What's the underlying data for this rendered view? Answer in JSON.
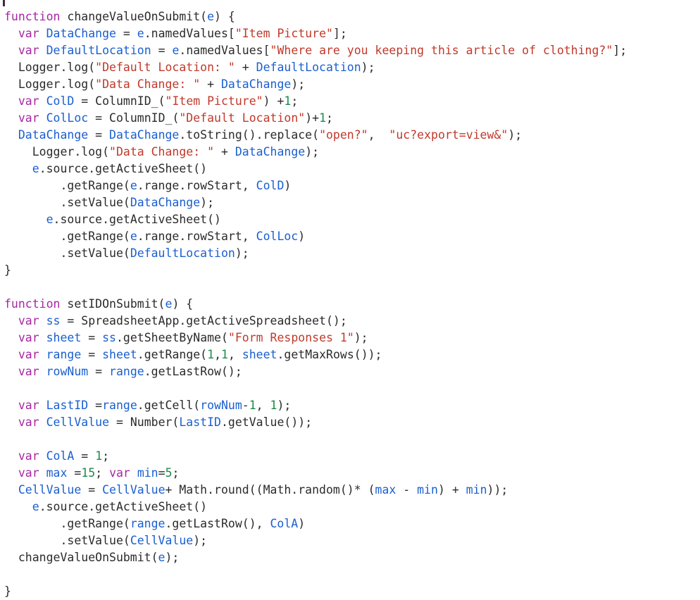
{
  "editor": {
    "name": "code-editor",
    "language": "JavaScript",
    "background_color": "#ffffff",
    "caret_visible": true,
    "theme_colors": {
      "keyword": "#a626a4",
      "identifier": "#1a5fd0",
      "string": "#c0392b",
      "number": "#1a8a4a",
      "plain": "#2b2b2b"
    }
  },
  "code": {
    "lines": [
      [
        {
          "t": "kw",
          "s": "function"
        },
        {
          "t": "plain",
          "s": " changeValueOnSubmit("
        },
        {
          "t": "ident",
          "s": "e"
        },
        {
          "t": "plain",
          "s": ") {"
        }
      ],
      [
        {
          "t": "plain",
          "s": "  "
        },
        {
          "t": "kw",
          "s": "var"
        },
        {
          "t": "plain",
          "s": " "
        },
        {
          "t": "ident",
          "s": "DataChange"
        },
        {
          "t": "plain",
          "s": " = "
        },
        {
          "t": "ident",
          "s": "e"
        },
        {
          "t": "plain",
          "s": ".namedValues["
        },
        {
          "t": "str",
          "s": "\"Item Picture\""
        },
        {
          "t": "plain",
          "s": "];"
        }
      ],
      [
        {
          "t": "plain",
          "s": "  "
        },
        {
          "t": "kw",
          "s": "var"
        },
        {
          "t": "plain",
          "s": " "
        },
        {
          "t": "ident",
          "s": "DefaultLocation"
        },
        {
          "t": "plain",
          "s": " = "
        },
        {
          "t": "ident",
          "s": "e"
        },
        {
          "t": "plain",
          "s": ".namedValues["
        },
        {
          "t": "str",
          "s": "\"Where are you keeping this article of clothing?\""
        },
        {
          "t": "plain",
          "s": "];"
        }
      ],
      [
        {
          "t": "plain",
          "s": "  Logger.log("
        },
        {
          "t": "str",
          "s": "\"Default Location: \""
        },
        {
          "t": "plain",
          "s": " + "
        },
        {
          "t": "ident",
          "s": "DefaultLocation"
        },
        {
          "t": "plain",
          "s": ");"
        }
      ],
      [
        {
          "t": "plain",
          "s": "  Logger.log("
        },
        {
          "t": "str",
          "s": "\"Data Change: \""
        },
        {
          "t": "plain",
          "s": " + "
        },
        {
          "t": "ident",
          "s": "DataChange"
        },
        {
          "t": "plain",
          "s": ");"
        }
      ],
      [
        {
          "t": "plain",
          "s": "  "
        },
        {
          "t": "kw",
          "s": "var"
        },
        {
          "t": "plain",
          "s": " "
        },
        {
          "t": "ident",
          "s": "ColD"
        },
        {
          "t": "plain",
          "s": " = ColumnID_("
        },
        {
          "t": "str",
          "s": "\"Item Picture\""
        },
        {
          "t": "plain",
          "s": ") +"
        },
        {
          "t": "num",
          "s": "1"
        },
        {
          "t": "plain",
          "s": ";"
        }
      ],
      [
        {
          "t": "plain",
          "s": "  "
        },
        {
          "t": "kw",
          "s": "var"
        },
        {
          "t": "plain",
          "s": " "
        },
        {
          "t": "ident",
          "s": "ColLoc"
        },
        {
          "t": "plain",
          "s": " = ColumnID_("
        },
        {
          "t": "str",
          "s": "\"Default Location\""
        },
        {
          "t": "plain",
          "s": ")+"
        },
        {
          "t": "num",
          "s": "1"
        },
        {
          "t": "plain",
          "s": ";"
        }
      ],
      [
        {
          "t": "plain",
          "s": "  "
        },
        {
          "t": "ident",
          "s": "DataChange"
        },
        {
          "t": "plain",
          "s": " = "
        },
        {
          "t": "ident",
          "s": "DataChange"
        },
        {
          "t": "plain",
          "s": ".toString().replace("
        },
        {
          "t": "str",
          "s": "\"open?\""
        },
        {
          "t": "plain",
          "s": ",  "
        },
        {
          "t": "str",
          "s": "\"uc?export=view&\""
        },
        {
          "t": "plain",
          "s": ");"
        }
      ],
      [
        {
          "t": "plain",
          "s": "    Logger.log("
        },
        {
          "t": "str",
          "s": "\"Data Change: \""
        },
        {
          "t": "plain",
          "s": " + "
        },
        {
          "t": "ident",
          "s": "DataChange"
        },
        {
          "t": "plain",
          "s": ");"
        }
      ],
      [
        {
          "t": "plain",
          "s": "    "
        },
        {
          "t": "ident",
          "s": "e"
        },
        {
          "t": "plain",
          "s": ".source.getActiveSheet()"
        }
      ],
      [
        {
          "t": "plain",
          "s": "        .getRange("
        },
        {
          "t": "ident",
          "s": "e"
        },
        {
          "t": "plain",
          "s": ".range.rowStart, "
        },
        {
          "t": "ident",
          "s": "ColD"
        },
        {
          "t": "plain",
          "s": ")"
        }
      ],
      [
        {
          "t": "plain",
          "s": "        .setValue("
        },
        {
          "t": "ident",
          "s": "DataChange"
        },
        {
          "t": "plain",
          "s": ");"
        }
      ],
      [
        {
          "t": "plain",
          "s": "      "
        },
        {
          "t": "ident",
          "s": "e"
        },
        {
          "t": "plain",
          "s": ".source.getActiveSheet()"
        }
      ],
      [
        {
          "t": "plain",
          "s": "        .getRange("
        },
        {
          "t": "ident",
          "s": "e"
        },
        {
          "t": "plain",
          "s": ".range.rowStart, "
        },
        {
          "t": "ident",
          "s": "ColLoc"
        },
        {
          "t": "plain",
          "s": ")"
        }
      ],
      [
        {
          "t": "plain",
          "s": "        .setValue("
        },
        {
          "t": "ident",
          "s": "DefaultLocation"
        },
        {
          "t": "plain",
          "s": ");"
        }
      ],
      [
        {
          "t": "plain",
          "s": "}"
        }
      ],
      [],
      [
        {
          "t": "kw",
          "s": "function"
        },
        {
          "t": "plain",
          "s": " setIDOnSubmit("
        },
        {
          "t": "ident",
          "s": "e"
        },
        {
          "t": "plain",
          "s": ") {"
        }
      ],
      [
        {
          "t": "plain",
          "s": "  "
        },
        {
          "t": "kw",
          "s": "var"
        },
        {
          "t": "plain",
          "s": " "
        },
        {
          "t": "ident",
          "s": "ss"
        },
        {
          "t": "plain",
          "s": " = SpreadsheetApp.getActiveSpreadsheet();"
        }
      ],
      [
        {
          "t": "plain",
          "s": "  "
        },
        {
          "t": "kw",
          "s": "var"
        },
        {
          "t": "plain",
          "s": " "
        },
        {
          "t": "ident",
          "s": "sheet"
        },
        {
          "t": "plain",
          "s": " = "
        },
        {
          "t": "ident",
          "s": "ss"
        },
        {
          "t": "plain",
          "s": ".getSheetByName("
        },
        {
          "t": "str",
          "s": "\"Form Responses 1\""
        },
        {
          "t": "plain",
          "s": ");"
        }
      ],
      [
        {
          "t": "plain",
          "s": "  "
        },
        {
          "t": "kw",
          "s": "var"
        },
        {
          "t": "plain",
          "s": " "
        },
        {
          "t": "ident",
          "s": "range"
        },
        {
          "t": "plain",
          "s": " = "
        },
        {
          "t": "ident",
          "s": "sheet"
        },
        {
          "t": "plain",
          "s": ".getRange("
        },
        {
          "t": "num",
          "s": "1"
        },
        {
          "t": "plain",
          "s": ","
        },
        {
          "t": "num",
          "s": "1"
        },
        {
          "t": "plain",
          "s": ", "
        },
        {
          "t": "ident",
          "s": "sheet"
        },
        {
          "t": "plain",
          "s": ".getMaxRows());"
        }
      ],
      [
        {
          "t": "plain",
          "s": "  "
        },
        {
          "t": "kw",
          "s": "var"
        },
        {
          "t": "plain",
          "s": " "
        },
        {
          "t": "ident",
          "s": "rowNum"
        },
        {
          "t": "plain",
          "s": " = "
        },
        {
          "t": "ident",
          "s": "range"
        },
        {
          "t": "plain",
          "s": ".getLastRow();"
        }
      ],
      [],
      [
        {
          "t": "plain",
          "s": "  "
        },
        {
          "t": "kw",
          "s": "var"
        },
        {
          "t": "plain",
          "s": " "
        },
        {
          "t": "ident",
          "s": "LastID"
        },
        {
          "t": "plain",
          "s": " ="
        },
        {
          "t": "ident",
          "s": "range"
        },
        {
          "t": "plain",
          "s": ".getCell("
        },
        {
          "t": "ident",
          "s": "rowNum"
        },
        {
          "t": "plain",
          "s": "-"
        },
        {
          "t": "num",
          "s": "1"
        },
        {
          "t": "plain",
          "s": ", "
        },
        {
          "t": "num",
          "s": "1"
        },
        {
          "t": "plain",
          "s": ");"
        }
      ],
      [
        {
          "t": "plain",
          "s": "  "
        },
        {
          "t": "kw",
          "s": "var"
        },
        {
          "t": "plain",
          "s": " "
        },
        {
          "t": "ident",
          "s": "CellValue"
        },
        {
          "t": "plain",
          "s": " = Number("
        },
        {
          "t": "ident",
          "s": "LastID"
        },
        {
          "t": "plain",
          "s": ".getValue());"
        }
      ],
      [],
      [
        {
          "t": "plain",
          "s": "  "
        },
        {
          "t": "kw",
          "s": "var"
        },
        {
          "t": "plain",
          "s": " "
        },
        {
          "t": "ident",
          "s": "ColA"
        },
        {
          "t": "plain",
          "s": " = "
        },
        {
          "t": "num",
          "s": "1"
        },
        {
          "t": "plain",
          "s": ";"
        }
      ],
      [
        {
          "t": "plain",
          "s": "  "
        },
        {
          "t": "kw",
          "s": "var"
        },
        {
          "t": "plain",
          "s": " "
        },
        {
          "t": "ident",
          "s": "max"
        },
        {
          "t": "plain",
          "s": " ="
        },
        {
          "t": "num",
          "s": "15"
        },
        {
          "t": "plain",
          "s": "; "
        },
        {
          "t": "kw",
          "s": "var"
        },
        {
          "t": "plain",
          "s": " "
        },
        {
          "t": "ident",
          "s": "min"
        },
        {
          "t": "plain",
          "s": "="
        },
        {
          "t": "num",
          "s": "5"
        },
        {
          "t": "plain",
          "s": ";"
        }
      ],
      [
        {
          "t": "plain",
          "s": "  "
        },
        {
          "t": "ident",
          "s": "CellValue"
        },
        {
          "t": "plain",
          "s": " = "
        },
        {
          "t": "ident",
          "s": "CellValue"
        },
        {
          "t": "plain",
          "s": "+ Math.round((Math.random()* ("
        },
        {
          "t": "ident",
          "s": "max"
        },
        {
          "t": "plain",
          "s": " - "
        },
        {
          "t": "ident",
          "s": "min"
        },
        {
          "t": "plain",
          "s": ") + "
        },
        {
          "t": "ident",
          "s": "min"
        },
        {
          "t": "plain",
          "s": "));"
        }
      ],
      [
        {
          "t": "plain",
          "s": "    "
        },
        {
          "t": "ident",
          "s": "e"
        },
        {
          "t": "plain",
          "s": ".source.getActiveSheet()"
        }
      ],
      [
        {
          "t": "plain",
          "s": "        .getRange("
        },
        {
          "t": "ident",
          "s": "range"
        },
        {
          "t": "plain",
          "s": ".getLastRow(), "
        },
        {
          "t": "ident",
          "s": "ColA"
        },
        {
          "t": "plain",
          "s": ")"
        }
      ],
      [
        {
          "t": "plain",
          "s": "        .setValue("
        },
        {
          "t": "ident",
          "s": "CellValue"
        },
        {
          "t": "plain",
          "s": ");"
        }
      ],
      [
        {
          "t": "plain",
          "s": "  changeValueOnSubmit("
        },
        {
          "t": "ident",
          "s": "e"
        },
        {
          "t": "plain",
          "s": ");"
        }
      ],
      [],
      [
        {
          "t": "plain",
          "s": "}"
        }
      ]
    ]
  }
}
